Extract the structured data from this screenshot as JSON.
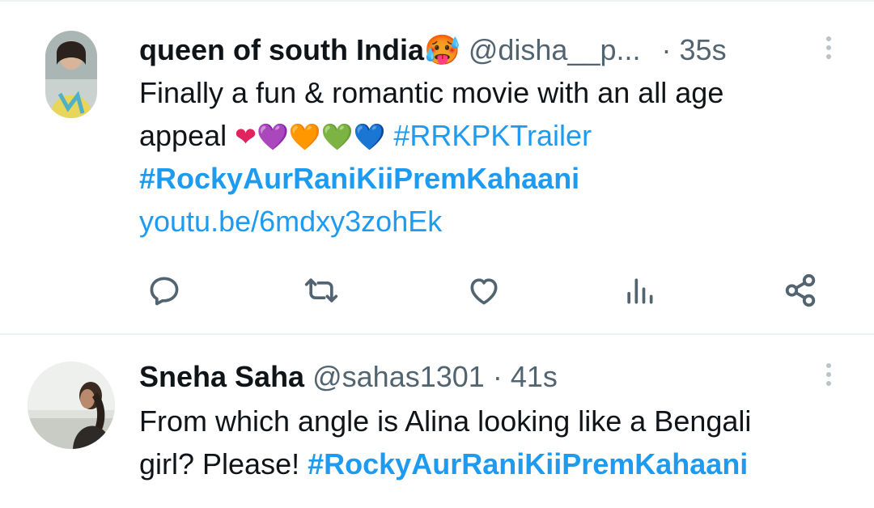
{
  "tweets": [
    {
      "name": "queen of south India",
      "name_emoji": "🥵",
      "handle": "@disha__p...",
      "time": "· 35s",
      "text_line1": "Finally a fun & romantic movie with an all age",
      "text_line2_prefix": "appeal",
      "hearts": [
        "❤",
        "💜",
        "🧡",
        "💚",
        "💙"
      ],
      "hashtag1": "#RRKPKTrailer",
      "hashtag2": "#RockyAurRaniKiiPremKahaani",
      "link": "youtu.be/6mdxy3zohEk",
      "actions": [
        "reply-icon",
        "retweet-icon",
        "like-icon",
        "views-icon",
        "share-icon"
      ]
    },
    {
      "name": "Sneha Saha",
      "handle": "@sahas1301",
      "time": "· 41s",
      "text_line1": "From which angle is Alina looking like a Bengali",
      "text_line2_prefix": "girl? Please!",
      "hashtag": "#RockyAurRaniKiiPremKahaani"
    }
  ],
  "colors": {
    "accent": "#1d9bf0",
    "text": "#0f1419",
    "secondary": "#536471",
    "icon": "#536471"
  }
}
